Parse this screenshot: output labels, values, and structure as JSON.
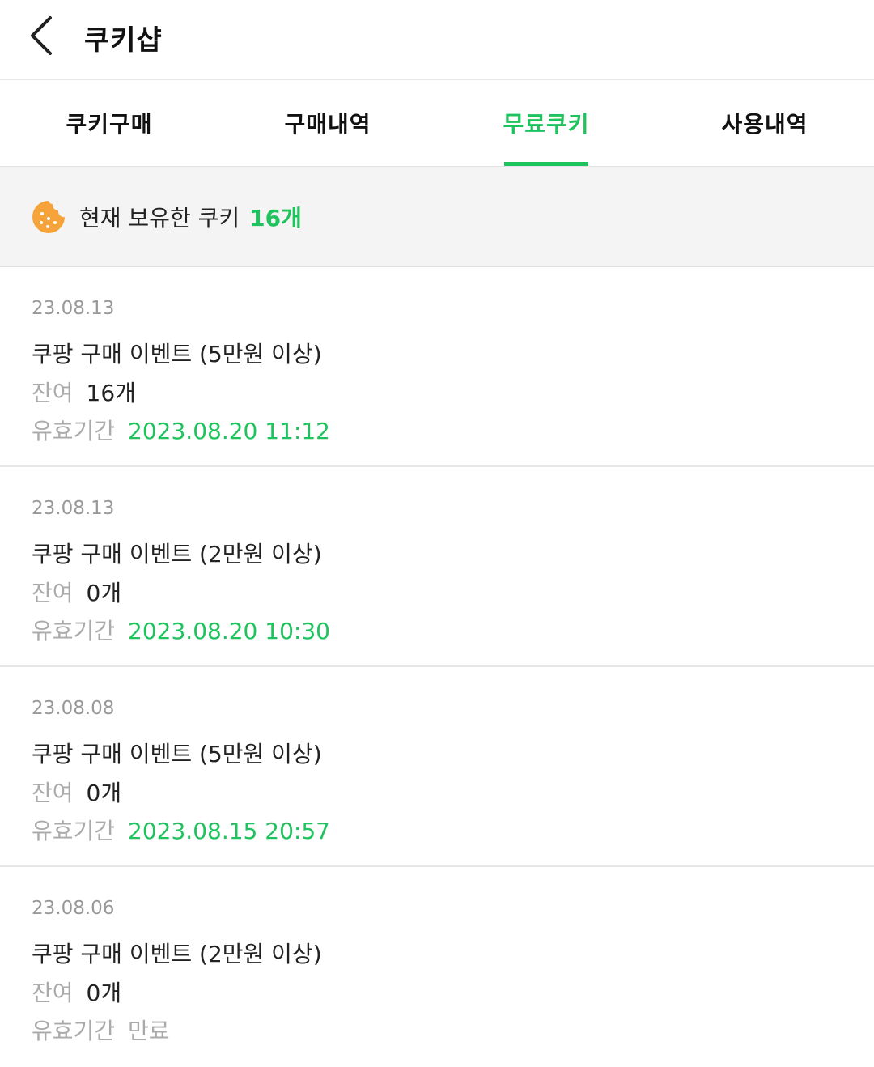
{
  "header": {
    "title": "쿠키샵"
  },
  "tabs": [
    {
      "label": "쿠키구매"
    },
    {
      "label": "구매내역"
    },
    {
      "label": "무료쿠키"
    },
    {
      "label": "사용내역"
    }
  ],
  "summary": {
    "label": "현재 보유한 쿠키",
    "count": "16개"
  },
  "items": [
    {
      "date": "23.08.13",
      "name": "쿠팡 구매 이벤트 (5만원 이상)",
      "remain_label": "잔여",
      "remain": "16개",
      "expire_label": "유효기간",
      "expire": "2023.08.20 11:12"
    },
    {
      "date": "23.08.13",
      "name": "쿠팡 구매 이벤트 (2만원 이상)",
      "remain_label": "잔여",
      "remain": "0개",
      "expire_label": "유효기간",
      "expire": "2023.08.20 10:30"
    },
    {
      "date": "23.08.08",
      "name": "쿠팡 구매 이벤트 (5만원 이상)",
      "remain_label": "잔여",
      "remain": "0개",
      "expire_label": "유효기간",
      "expire": "2023.08.15 20:57"
    },
    {
      "date": "23.08.06",
      "name": "쿠팡 구매 이벤트 (2만원 이상)",
      "remain_label": "잔여",
      "remain": "0개",
      "expire_label": "유효기간",
      "expire": "만료"
    }
  ],
  "colors": {
    "accent": "#1fc35e",
    "cookie": "#f7a33b"
  },
  "icons": {
    "back": "chevron-left-icon",
    "cookie": "cookie-icon"
  }
}
